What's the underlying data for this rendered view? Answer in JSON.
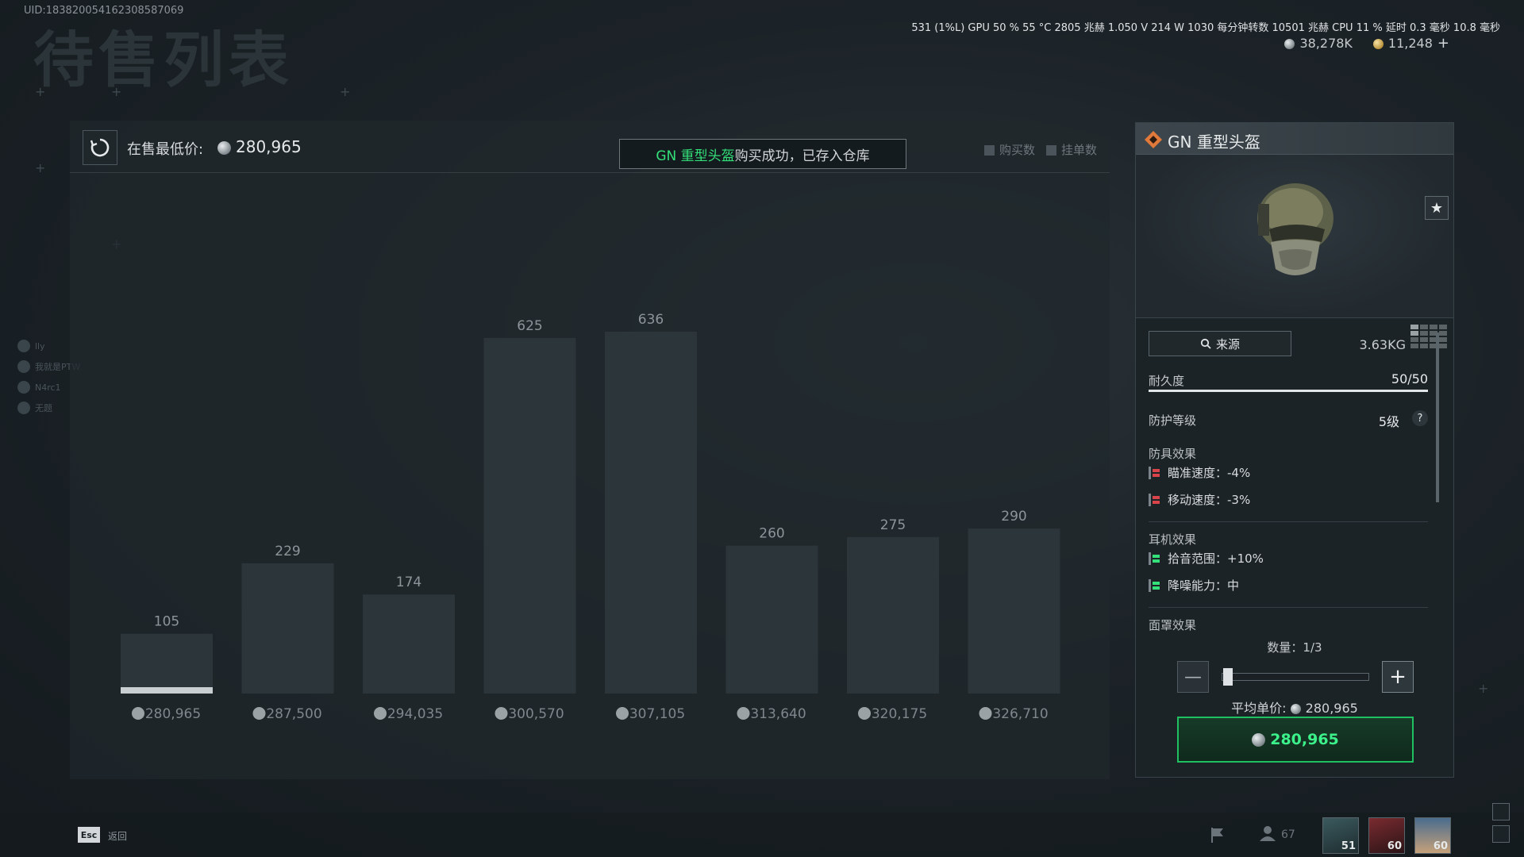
{
  "header": {
    "uid": "UID:183820054162308587069",
    "page_title": "待售列表",
    "perf": "531 (1%L) GPU 50 % 55 °C 2805 兆赫 1.050 V 214 W 1030 每分钟转数 10501 兆赫 CPU 11 % 延时 0.3 毫秒 10.8 毫秒",
    "currency_silver": "38,278K",
    "currency_gold": "11,248",
    "currency_plus": "+"
  },
  "side_list": [
    "lly",
    "我就是PTW",
    "N4rc1",
    "无题"
  ],
  "chart_panel": {
    "min_price_label": "在售最低价:",
    "min_price": "280,965",
    "notice_item": "GN 重型头盔",
    "notice_text": "购买成功，已存入仓库",
    "legend_buy": "购买数",
    "legend_list": "挂单数"
  },
  "chart_data": {
    "type": "bar",
    "categories": [
      "280,965",
      "287,500",
      "294,035",
      "300,570",
      "307,105",
      "313,640",
      "320,175",
      "326,710"
    ],
    "values": [
      105,
      229,
      174,
      625,
      636,
      260,
      275,
      290
    ],
    "ylim": [
      0,
      636
    ]
  },
  "item": {
    "name": "GN 重型头盔",
    "weight": "3.63KG",
    "source_button": "来源",
    "durability_label": "耐久度",
    "durability_value": "50/50",
    "durability_fraction": 1.0,
    "protection_label": "防护等级",
    "protection_value": "5级",
    "help_glyph": "?",
    "armor_effects_title": "防具效果",
    "armor_effects": [
      "瞄准速度：-4%",
      "移动速度：-3%"
    ],
    "ear_effects_title": "耳机效果",
    "ear_effects": [
      "拾音范围：+10%",
      "降噪能力：中"
    ],
    "mask_effects_title": "面罩效果",
    "quantity_label": "数量：1/3",
    "avg_price_label": "平均单价:",
    "avg_price": "280,965",
    "buy_price": "280,965",
    "colors": {
      "accent_green": "#34e07a",
      "warn_red": "#d9434a"
    }
  },
  "bottom": {
    "esc_key": "Esc",
    "esc_label": "返回",
    "friends_count": "67",
    "squad": [
      {
        "level": "51"
      },
      {
        "level": "60"
      },
      {
        "level": "60"
      }
    ]
  }
}
